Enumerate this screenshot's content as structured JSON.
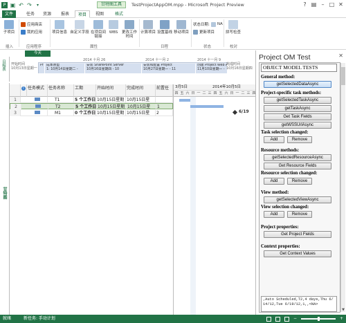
{
  "window": {
    "title": "TestProjectAppOM.mpp - Microsoft Project Preview",
    "context_tab_group": "甘特图工具",
    "user": "Em"
  },
  "quick_access": {
    "save_icon": "save-icon",
    "undo_icon": "undo-icon",
    "redo_icon": "redo-icon"
  },
  "tabs": {
    "file": "文件",
    "task": "任务",
    "resource": "资源",
    "report": "报表",
    "project": "项目",
    "view": "视图",
    "format": "格式"
  },
  "ribbon": {
    "subproject": "子项目",
    "app_store": "应用商店",
    "my_apps": "我的应用",
    "project_info": "项目信息",
    "custom_fields": "自定义字段",
    "links_between": "在项目间链接",
    "wbs": "WBS",
    "change_working_time": "更改工作时间",
    "calculate_project": "计算项目",
    "set_baseline": "设置基线",
    "move_project": "移动项目",
    "status_date_label": "状态日期:",
    "status_date_value": "NA",
    "update_project": "更新项目",
    "spelling": "拼写检查",
    "group_insert": "插入",
    "group_apps": "应用程序",
    "group_properties": "属性",
    "group_schedule": "日程",
    "group_status": "状态",
    "group_proofing": "校对"
  },
  "timeline": {
    "today": "今天",
    "side_label": "日程表",
    "start_label": "开始时间",
    "start_value": "10月13日星期一",
    "end_label": "完成时间",
    "end_value": "10月16日星期四",
    "ticks": [
      "2014 十月 26",
      "2014 十一月 2",
      "2014 十一月 9"
    ],
    "segments": [
      {
        "name": "Pr",
        "date": ""
      },
      {
        "name": "成本原型",
        "date": "1: 10月14日星期二 -"
      },
      {
        "name": "安装 SharePoint Server",
        "date": "10月16日星期四 - 10"
      },
      {
        "name": "安装和配置 Project",
        "date": "10月27日星期一 - 11"
      },
      {
        "name": "创建 Project Web A",
        "date": "11月10日星期一 -"
      }
    ]
  },
  "gantt_side_label": "甘特图",
  "table": {
    "headers": [
      "",
      "任务模式",
      "任务名称",
      "工期",
      "开始时间",
      "完成时间",
      "前置任"
    ],
    "rows": [
      {
        "num": "1",
        "name": "T1",
        "duration": "5 个工作日",
        "start": "10月15日星期",
        "finish": "10月15日星",
        "pred": ""
      },
      {
        "num": "2",
        "name": "T2",
        "duration": "5 个工作日",
        "start": "10月15日星期",
        "finish": "10月15日星",
        "pred": "1"
      },
      {
        "num": "3",
        "name": "M1",
        "duration": "0 个工作日",
        "start": "10月15日星期",
        "finish": "10月15日星",
        "pred": "2"
      }
    ]
  },
  "gantt": {
    "week1": "3月5日",
    "week2": "2014年10月5日",
    "days": [
      "四",
      "五",
      "六",
      "日",
      "一",
      "二",
      "三",
      "四",
      "五",
      "六",
      "日",
      "一",
      "二",
      "三",
      "四"
    ],
    "milestone_label": "6/19"
  },
  "pane": {
    "title": "Project OM Test",
    "header": "OBJECT MODEL TESTS",
    "general_method": "General method:",
    "btn_get_selected_data": "getSelectedDataAsync",
    "project_task_methods": "Project-specific task methods:",
    "btn_get_selected_task": "getSelectedTaskAsync",
    "btn_get_task": "getTaskAsync",
    "btn_get_task_fields": "Get Task Fields",
    "btn_get_wss_url": "getWSSUrlAsync",
    "task_selection_changed": "Task selection changed:",
    "btn_add": "Add",
    "btn_remove": "Remove",
    "resource_methods": "Resource methods:",
    "btn_get_selected_resource": "getSelectedResourceAsync",
    "btn_get_resource_fields": "Get Resource Fields",
    "resource_selection_changed": "Resource selection changed:",
    "view_method": "View method:",
    "btn_get_selected_view": "getSelectedViewAsync",
    "view_selection_changed": "View selection changed:",
    "project_properties": "Project properties:",
    "btn_get_project_fields": "Get Project Fields",
    "context_properties": "Context properties:",
    "btn_get_context_values": "Get Context Values",
    "output": ",Auto Scheduled,T2,4 days,Thu 6/14/12,Tue 6/19/12,1,,<NA>"
  },
  "status": {
    "ready": "就绪",
    "new_tasks": "新任务: 手动计划"
  },
  "colors": {
    "accent": "#217346",
    "selected_row": "#d9e8d4",
    "gantt_bar": "#8fb4e3"
  }
}
